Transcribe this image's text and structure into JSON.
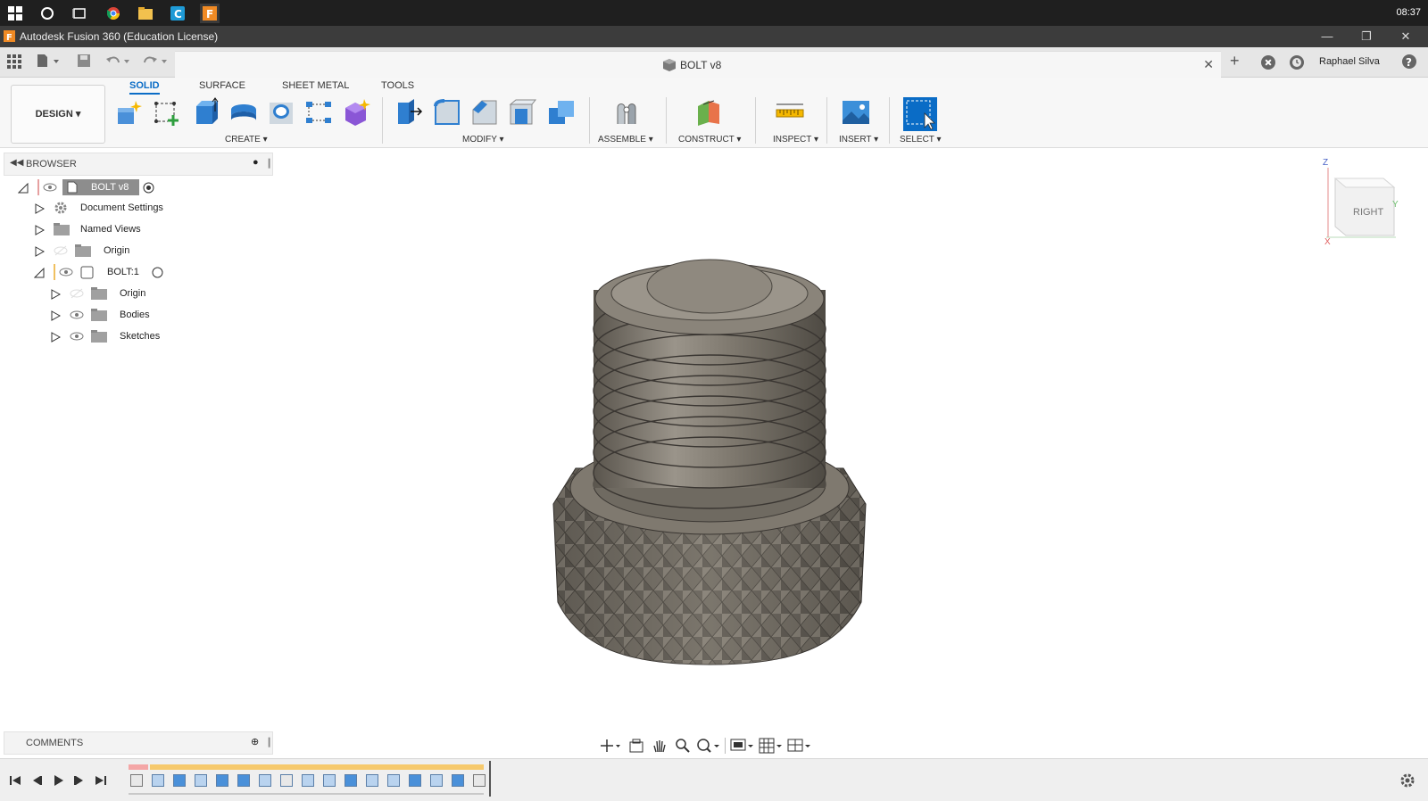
{
  "taskbar": {
    "clock": "08:37",
    "icons": [
      "windows-start-icon",
      "search-circle-icon",
      "task-view-icon",
      "chrome-icon",
      "file-explorer-icon",
      "cortana-c-icon",
      "fusion-app-icon"
    ]
  },
  "titlebar": {
    "title": "Autodesk Fusion 360 (Education License)"
  },
  "tabbar": {
    "doc_name": "BOLT v8",
    "user": "Raphael Silva"
  },
  "ribbon": {
    "workspace": "DESIGN",
    "tabs": [
      "SOLID",
      "SURFACE",
      "SHEET METAL",
      "TOOLS"
    ],
    "active_tab": "SOLID",
    "groups": {
      "create": "CREATE",
      "modify": "MODIFY",
      "assemble": "ASSEMBLE",
      "construct": "CONSTRUCT",
      "inspect": "INSPECT",
      "insert": "INSERT",
      "select": "SELECT"
    }
  },
  "browser": {
    "title": "BROWSER",
    "root": "BOLT v8",
    "items": [
      {
        "label": "Document Settings"
      },
      {
        "label": "Named Views"
      },
      {
        "label": "Origin"
      },
      {
        "label": "BOLT:1"
      },
      {
        "label": "Origin"
      },
      {
        "label": "Bodies"
      },
      {
        "label": "Sketches"
      }
    ]
  },
  "comments": {
    "title": "COMMENTS"
  },
  "viewcube": {
    "face": "RIGHT",
    "axis_z": "Z",
    "axis_y": "Y",
    "axis_x": "X"
  },
  "colors": {
    "accent": "#0a6cc6",
    "model": "#7d776d",
    "titlebar": "#3c3c3c"
  }
}
